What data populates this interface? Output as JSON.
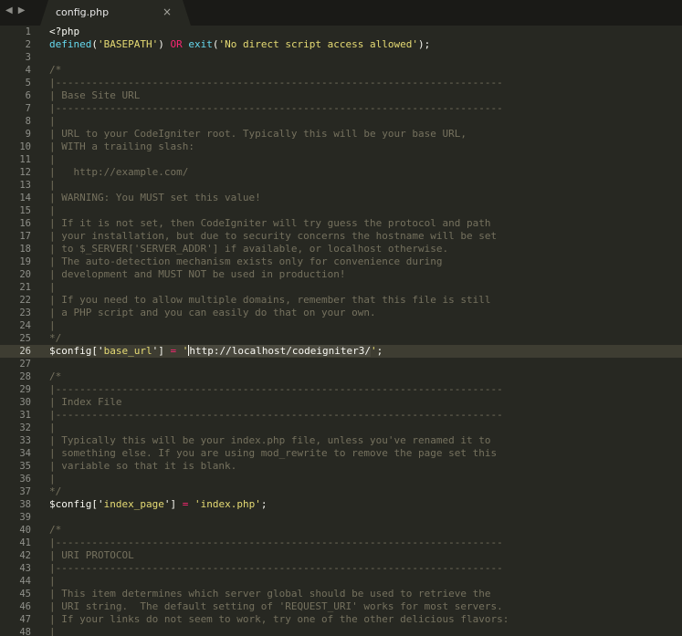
{
  "tabs": [
    {
      "title": "config.php",
      "close_glyph": "×"
    }
  ],
  "nav": {
    "back_glyph": "◀",
    "forward_glyph": "▶"
  },
  "colors": {
    "background": "#272822",
    "tabbar": "#1a1a17",
    "string": "#e6db74",
    "function": "#66d9ef",
    "operator": "#f92672",
    "comment": "#75715e",
    "text": "#f8f8f2"
  },
  "editor": {
    "current_line": 26,
    "lines": [
      {
        "n": "1",
        "tokens": [
          {
            "t": "<?php",
            "c": "plain"
          }
        ]
      },
      {
        "n": "2",
        "tokens": [
          {
            "t": "defined",
            "c": "func"
          },
          {
            "t": "(",
            "c": "plain"
          },
          {
            "t": "'BASEPATH'",
            "c": "string"
          },
          {
            "t": ") ",
            "c": "plain"
          },
          {
            "t": "OR",
            "c": "operator"
          },
          {
            "t": " ",
            "c": "plain"
          },
          {
            "t": "exit",
            "c": "func"
          },
          {
            "t": "(",
            "c": "plain"
          },
          {
            "t": "'No direct script access allowed'",
            "c": "string"
          },
          {
            "t": ");",
            "c": "plain"
          }
        ]
      },
      {
        "n": "3",
        "tokens": []
      },
      {
        "n": "4",
        "tokens": [
          {
            "t": "/*",
            "c": "comment"
          }
        ]
      },
      {
        "n": "5",
        "tokens": [
          {
            "t": "|--------------------------------------------------------------------------",
            "c": "comment"
          }
        ]
      },
      {
        "n": "6",
        "tokens": [
          {
            "t": "| Base Site URL",
            "c": "comment"
          }
        ]
      },
      {
        "n": "7",
        "tokens": [
          {
            "t": "|--------------------------------------------------------------------------",
            "c": "comment"
          }
        ]
      },
      {
        "n": "8",
        "tokens": [
          {
            "t": "|",
            "c": "comment"
          }
        ]
      },
      {
        "n": "9",
        "tokens": [
          {
            "t": "| URL to your CodeIgniter root. Typically this will be your base URL,",
            "c": "comment"
          }
        ]
      },
      {
        "n": "10",
        "tokens": [
          {
            "t": "| WITH a trailing slash:",
            "c": "comment"
          }
        ]
      },
      {
        "n": "11",
        "tokens": [
          {
            "t": "|",
            "c": "comment"
          }
        ]
      },
      {
        "n": "12",
        "tokens": [
          {
            "t": "|   http://example.com/",
            "c": "comment"
          }
        ]
      },
      {
        "n": "13",
        "tokens": [
          {
            "t": "|",
            "c": "comment"
          }
        ]
      },
      {
        "n": "14",
        "tokens": [
          {
            "t": "| WARNING: You MUST set this value!",
            "c": "comment"
          }
        ]
      },
      {
        "n": "15",
        "tokens": [
          {
            "t": "|",
            "c": "comment"
          }
        ]
      },
      {
        "n": "16",
        "tokens": [
          {
            "t": "| If it is not set, then CodeIgniter will try guess the protocol and path",
            "c": "comment"
          }
        ]
      },
      {
        "n": "17",
        "tokens": [
          {
            "t": "| your installation, but due to security concerns the hostname will be set",
            "c": "comment"
          }
        ]
      },
      {
        "n": "18",
        "tokens": [
          {
            "t": "| to $_SERVER['SERVER_ADDR'] if available, or localhost otherwise.",
            "c": "comment"
          }
        ]
      },
      {
        "n": "19",
        "tokens": [
          {
            "t": "| The auto-detection mechanism exists only for convenience during",
            "c": "comment"
          }
        ]
      },
      {
        "n": "20",
        "tokens": [
          {
            "t": "| development and MUST NOT be used in production!",
            "c": "comment"
          }
        ]
      },
      {
        "n": "21",
        "tokens": [
          {
            "t": "|",
            "c": "comment"
          }
        ]
      },
      {
        "n": "22",
        "tokens": [
          {
            "t": "| If you need to allow multiple domains, remember that this file is still",
            "c": "comment"
          }
        ]
      },
      {
        "n": "23",
        "tokens": [
          {
            "t": "| a PHP script and you can easily do that on your own.",
            "c": "comment"
          }
        ]
      },
      {
        "n": "24",
        "tokens": [
          {
            "t": "|",
            "c": "comment"
          }
        ]
      },
      {
        "n": "25",
        "tokens": [
          {
            "t": "*/",
            "c": "comment"
          }
        ]
      },
      {
        "n": "26",
        "tokens": [
          {
            "t": "$config",
            "c": "var"
          },
          {
            "t": "['",
            "c": "plain"
          },
          {
            "t": "base_url",
            "c": "string"
          },
          {
            "t": "'] ",
            "c": "plain"
          },
          {
            "t": "=",
            "c": "operator"
          },
          {
            "t": " '",
            "c": "string"
          },
          {
            "t": "|",
            "c": "caret"
          },
          {
            "t": "http://localhost/codeigniter3/",
            "c": "selected"
          },
          {
            "t": "'",
            "c": "string"
          },
          {
            "t": ";",
            "c": "plain"
          }
        ]
      },
      {
        "n": "27",
        "tokens": []
      },
      {
        "n": "28",
        "tokens": [
          {
            "t": "/*",
            "c": "comment"
          }
        ]
      },
      {
        "n": "29",
        "tokens": [
          {
            "t": "|--------------------------------------------------------------------------",
            "c": "comment"
          }
        ]
      },
      {
        "n": "30",
        "tokens": [
          {
            "t": "| Index File",
            "c": "comment"
          }
        ]
      },
      {
        "n": "31",
        "tokens": [
          {
            "t": "|--------------------------------------------------------------------------",
            "c": "comment"
          }
        ]
      },
      {
        "n": "32",
        "tokens": [
          {
            "t": "|",
            "c": "comment"
          }
        ]
      },
      {
        "n": "33",
        "tokens": [
          {
            "t": "| Typically this will be your index.php file, unless you've renamed it to",
            "c": "comment"
          }
        ]
      },
      {
        "n": "34",
        "tokens": [
          {
            "t": "| something else. If you are using mod_rewrite to remove the page set this",
            "c": "comment"
          }
        ]
      },
      {
        "n": "35",
        "tokens": [
          {
            "t": "| variable so that it is blank.",
            "c": "comment"
          }
        ]
      },
      {
        "n": "36",
        "tokens": [
          {
            "t": "|",
            "c": "comment"
          }
        ]
      },
      {
        "n": "37",
        "tokens": [
          {
            "t": "*/",
            "c": "comment"
          }
        ]
      },
      {
        "n": "38",
        "tokens": [
          {
            "t": "$config",
            "c": "var"
          },
          {
            "t": "['",
            "c": "plain"
          },
          {
            "t": "index_page",
            "c": "string"
          },
          {
            "t": "'] ",
            "c": "plain"
          },
          {
            "t": "=",
            "c": "operator"
          },
          {
            "t": " ",
            "c": "plain"
          },
          {
            "t": "'index.php'",
            "c": "string"
          },
          {
            "t": ";",
            "c": "plain"
          }
        ]
      },
      {
        "n": "39",
        "tokens": []
      },
      {
        "n": "40",
        "tokens": [
          {
            "t": "/*",
            "c": "comment"
          }
        ]
      },
      {
        "n": "41",
        "tokens": [
          {
            "t": "|--------------------------------------------------------------------------",
            "c": "comment"
          }
        ]
      },
      {
        "n": "42",
        "tokens": [
          {
            "t": "| URI PROTOCOL",
            "c": "comment"
          }
        ]
      },
      {
        "n": "43",
        "tokens": [
          {
            "t": "|--------------------------------------------------------------------------",
            "c": "comment"
          }
        ]
      },
      {
        "n": "44",
        "tokens": [
          {
            "t": "|",
            "c": "comment"
          }
        ]
      },
      {
        "n": "45",
        "tokens": [
          {
            "t": "| This item determines which server global should be used to retrieve the",
            "c": "comment"
          }
        ]
      },
      {
        "n": "46",
        "tokens": [
          {
            "t": "| URI string.  The default setting of 'REQUEST_URI' works for most servers.",
            "c": "comment"
          }
        ]
      },
      {
        "n": "47",
        "tokens": [
          {
            "t": "| If your links do not seem to work, try one of the other delicious flavors:",
            "c": "comment"
          }
        ]
      },
      {
        "n": "48",
        "tokens": [
          {
            "t": "|",
            "c": "comment"
          }
        ]
      }
    ]
  }
}
